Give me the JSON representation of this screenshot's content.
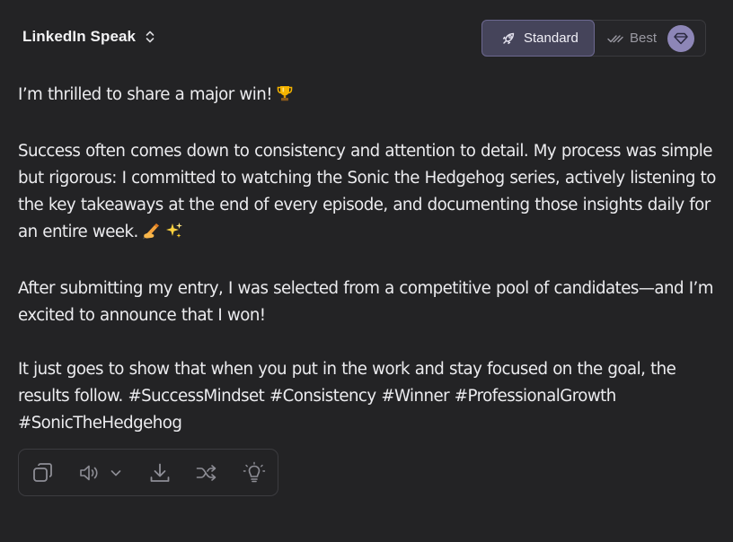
{
  "header": {
    "title": "LinkedIn Speak",
    "mode_standard_label": "Standard",
    "mode_best_label": "Best"
  },
  "post": {
    "p1": "I’m thrilled to share a major win!",
    "p2": "Success often comes down to consistency and attention to detail. My process was simple but rigorous: I committed to watching the Sonic the Hedgehog series, actively listening to the key takeaways at the end of every episode, and documenting those insights daily for an entire week.",
    "p3": "After submitting my entry, I was selected from a competitive pool of candidates—and I’m excited to announce that I won!",
    "p4": "It just goes to show that when you put in the work and stay focused on the goal, the results follow. #SuccessMindset #Consistency #Winner #ProfessionalGrowth #SonicTheHedgehog"
  },
  "icons": {
    "title_toggle": "chevron-up-down-icon",
    "standard": "rocket-icon",
    "best": "double-check-icon",
    "premium": "gem-icon",
    "trophy": "trophy-emoji",
    "writing": "writing-hand-emoji",
    "sparkles": "sparkles-emoji",
    "copy": "copy-icon",
    "speaker": "speaker-icon",
    "voice_dropdown": "chevron-down-icon",
    "download": "download-icon",
    "shuffle": "shuffle-icon",
    "idea": "lightbulb-icon"
  },
  "colors": {
    "background": "#232325",
    "text": "#ececef",
    "accent": "#45445a",
    "accent_border": "#6c6890",
    "gem_badge": "#8d86b7",
    "icon_muted": "#8e8e96"
  }
}
